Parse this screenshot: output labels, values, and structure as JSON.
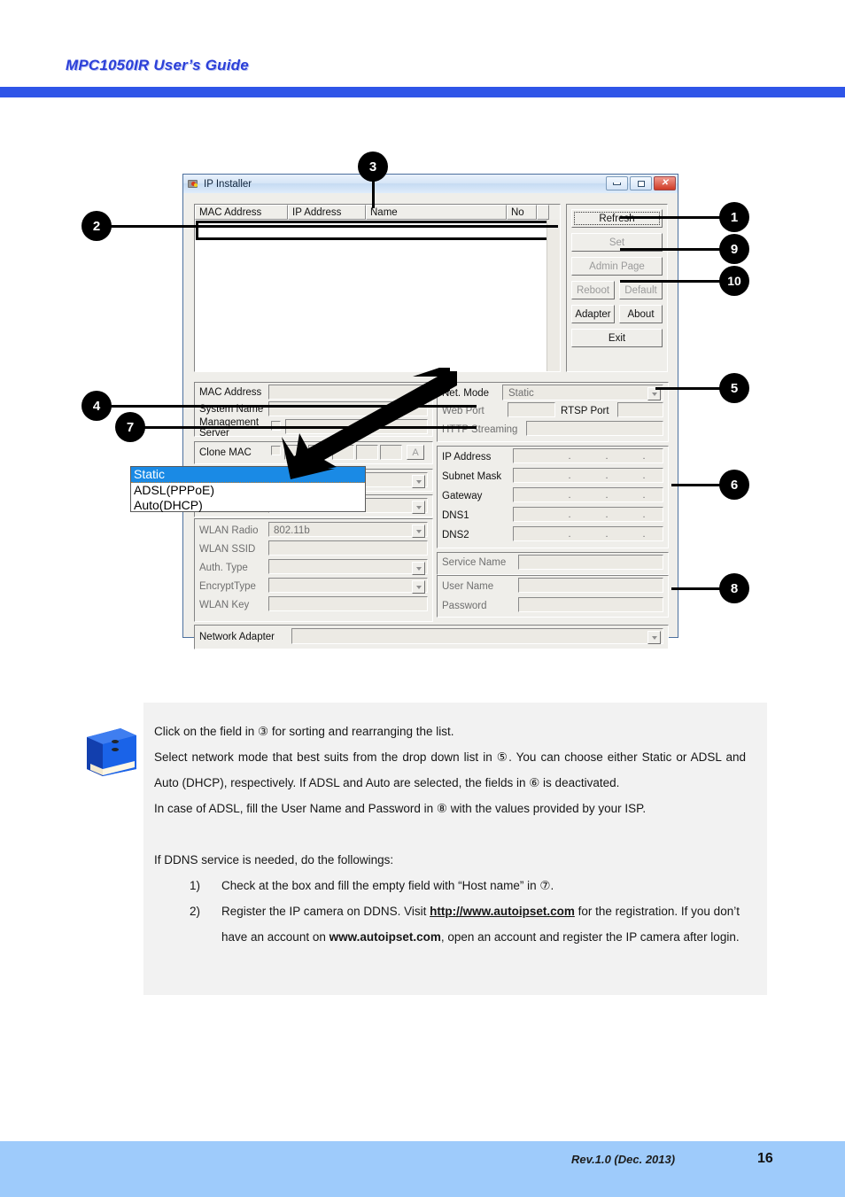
{
  "header": {
    "title": "MPC1050IR User’s Guide"
  },
  "footer": {
    "revision": "Rev.1.0 (Dec. 2013)",
    "page_number": "16"
  },
  "dialog": {
    "title": "IP Installer",
    "window_buttons": {
      "minimize": "minimize-icon",
      "maximize": "maximize-icon",
      "close": "✕"
    },
    "list": {
      "columns": [
        "MAC Address",
        "IP Address",
        "Name",
        "No"
      ],
      "rows": []
    },
    "buttons": {
      "refresh": "Refresh",
      "set": "Set",
      "admin_page": "Admin Page",
      "reboot": "Reboot",
      "default": "Default",
      "adapter": "Adapter",
      "about": "About",
      "exit": "Exit"
    },
    "left_form": {
      "mac_address_label": "MAC Address",
      "mac_address_value": "",
      "system_name_label": "System Name",
      "system_name_value": "",
      "management_server_label_line1": "Management",
      "management_server_label_line2": "Server",
      "management_server_value": "",
      "clone_mac_label": "Clone MAC",
      "clone_mac_button": "A"
    },
    "wlan": {
      "radio_label": "WLAN Radio",
      "radio_value": "802.11b",
      "ssid_label": "WLAN SSID",
      "ssid_value": "",
      "auth_type_label": "Auth. Type",
      "auth_type_value": "",
      "encrypt_type_label": "EncryptType",
      "encrypt_type_value": "",
      "wlan_key_label": "WLAN Key",
      "wlan_key_value": ""
    },
    "net_mode": {
      "label": "Net. Mode",
      "value": "Static",
      "options": [
        "Static",
        "ADSL(PPPoE)",
        "Auto(DHCP)"
      ],
      "selected_option": "Static"
    },
    "ports": {
      "web_port_label": "Web Port",
      "web_port_value": "",
      "rtsp_port_label": "RTSP Port",
      "rtsp_port_value": "",
      "http_streaming_label": "HTTP Streaming",
      "http_streaming_value": ""
    },
    "ip_group": {
      "ip_address_label": "IP Address",
      "subnet_mask_label": "Subnet Mask",
      "gateway_label": "Gateway",
      "dns1_label": "DNS1",
      "dns2_label": "DNS2",
      "octet_separator": "."
    },
    "credentials": {
      "service_name_label": "Service Name",
      "service_name_value": "",
      "user_name_label": "User Name",
      "user_name_value": "",
      "password_label": "Password",
      "password_value": ""
    },
    "network_adapter": {
      "label": "Network Adapter",
      "value": ""
    }
  },
  "callouts": [
    {
      "id": "1",
      "number": "1"
    },
    {
      "id": "2",
      "number": "2"
    },
    {
      "id": "3",
      "number": "3"
    },
    {
      "id": "4",
      "number": "4"
    },
    {
      "id": "5",
      "number": "5"
    },
    {
      "id": "6",
      "number": "6"
    },
    {
      "id": "7",
      "number": "7"
    },
    {
      "id": "8",
      "number": "8"
    },
    {
      "id": "9",
      "number": "9"
    },
    {
      "id": "10",
      "number": "10"
    }
  ],
  "note": {
    "paragraph1": "Click on the field in ③ for sorting and rearranging the list.",
    "paragraph2": "Select network mode that best suits from the drop down list in ⑤. You can choose either Static or ADSL and Auto (DHCP), respectively. If ADSL and Auto are selected, the fields in ⑥ is deactivated.",
    "paragraph3": "In case of ADSL, fill the User Name and Password in ⑧ with the values provided by your ISP.",
    "paragraph4": "If DDNS service is needed, do the followings:",
    "list": [
      {
        "marker": "1)",
        "text": "Check at the box and fill the empty field with “Host name” in ⑦."
      },
      {
        "marker": "2)",
        "text_before": "Register the IP camera on DDNS. Visit ",
        "link": "http://www.autoipset.com",
        "text_middle": " for the registration. If you don’t have an account on ",
        "bold": "www.autoipset.com",
        "text_after": ", open an account and register the IP camera after login."
      }
    ]
  },
  "colors": {
    "header_blue": "#2f55e8",
    "footer_blue": "#9ecbfb",
    "selection_blue": "#1a8ae5",
    "note_bg": "#f2f2f2"
  }
}
